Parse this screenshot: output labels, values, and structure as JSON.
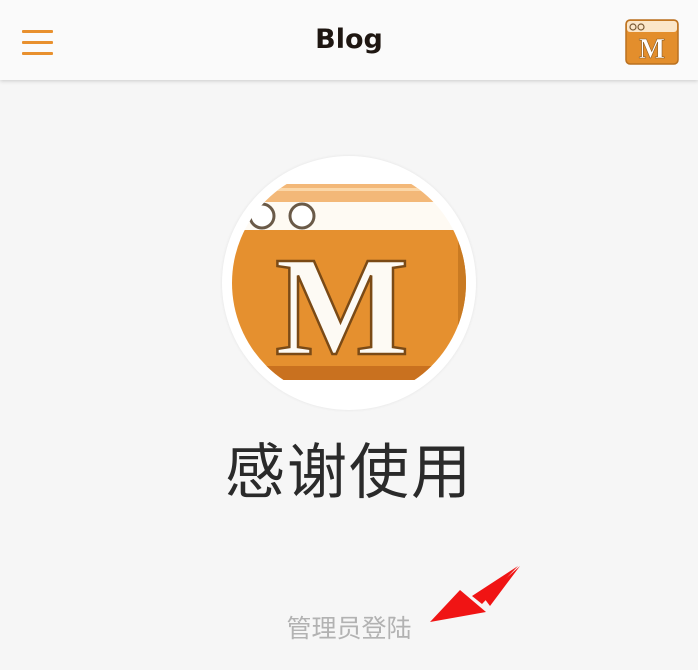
{
  "header": {
    "title": "Blog",
    "menu_icon": "hamburger-menu-icon",
    "logo_letter": "M"
  },
  "main": {
    "avatar_letter": "M",
    "thanks_text": "感谢使用",
    "admin_login_label": "管理员登陆"
  },
  "colors": {
    "accent": "#e8902e",
    "title": "#1e1611",
    "background": "#f6f6f6",
    "muted_text": "#b2b2b2",
    "annotation_arrow": "#f01414"
  }
}
